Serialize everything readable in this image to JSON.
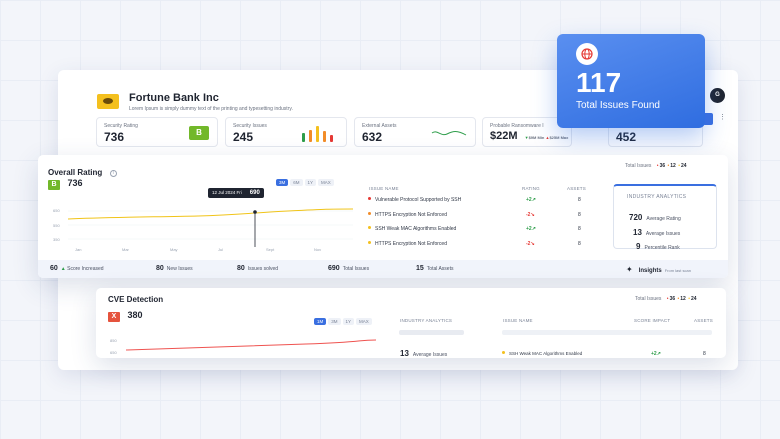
{
  "company": {
    "name": "Fortune Bank Inc",
    "description": "Lorem Ipsum is simply dummy text of the printing and typesetting industry."
  },
  "stats": {
    "security_rating": {
      "label": "Security Rating",
      "value": "736",
      "grade": "B"
    },
    "security_issues": {
      "label": "Security Issues",
      "value": "245"
    },
    "external_assets": {
      "label": "External Assets",
      "value": "632"
    },
    "ransomware": {
      "label": "Probable Ransomware I",
      "value": "$22M",
      "min": "$9M",
      "min_label": "Min",
      "max": "$25M",
      "max_label": "Max"
    },
    "extra": {
      "value": "452"
    }
  },
  "avatar": {
    "initial": "G"
  },
  "total_card": {
    "value": "117",
    "label": "Total Issues Found"
  },
  "overall": {
    "title": "Overall Rating",
    "grade": "B",
    "score": "736",
    "total_issues_label": "Total Issues",
    "ti_a": "36",
    "ti_b": "12",
    "ti_c": "24",
    "tabs": [
      "3M",
      "6M",
      "1Y",
      "MAX"
    ],
    "tooltip_date": "12 Jul 2024 Fri",
    "tooltip_value": "690",
    "ylabels": [
      "650",
      "550",
      "350"
    ],
    "xlabels": [
      "Jan",
      "Mar",
      "May",
      "Jul",
      "Sept",
      "Nov"
    ]
  },
  "issues": {
    "headers": {
      "name": "Issue Name",
      "rating": "Rating",
      "assets": "Assets"
    },
    "rows": [
      {
        "name": "Vulnerable Protocol Supported by SSH",
        "rating": "+2",
        "assets": "8",
        "dot": "#e53935",
        "rating_color": "#2e9d4a"
      },
      {
        "name": "HTTPS Encryption Not Enforced",
        "rating": "-2",
        "assets": "8",
        "dot": "#f28c28",
        "rating_color": "#e53935"
      },
      {
        "name": "SSH Weak MAC Algorithms Enabled",
        "rating": "+2",
        "assets": "8",
        "dot": "#f4c01e",
        "rating_color": "#2e9d4a"
      },
      {
        "name": "HTTPS Encryption Not Enforced",
        "rating": "-2",
        "assets": "8",
        "dot": "#f4c01e",
        "rating_color": "#e53935"
      }
    ]
  },
  "industry": {
    "title": "INDUSTRY ANALYTICS",
    "items": [
      {
        "value": "720",
        "label": "Average Rating"
      },
      {
        "value": "13",
        "label": "Average Issues"
      },
      {
        "value": "9",
        "label": "Percentile Rank"
      }
    ]
  },
  "footer": {
    "score_increased": {
      "value": "60",
      "label": "Score Increased"
    },
    "new_issues": {
      "value": "80",
      "label": "New Issues"
    },
    "issues_solved": {
      "value": "80",
      "label": "Issues solved"
    },
    "total_issues": {
      "value": "690",
      "label": "Total Issues"
    },
    "total_assets": {
      "value": "15",
      "label": "Total Assets"
    },
    "insights": {
      "label": "Insights",
      "sub": "From last scan"
    }
  },
  "cve": {
    "title": "CVE Detection",
    "grade": "X",
    "score": "380",
    "tabs": [
      "1M",
      "3M",
      "1Y",
      "MAX"
    ],
    "total_issues_label": "Total Issues",
    "ti_a": "36",
    "ti_b": "12",
    "ti_c": "24",
    "industry_title": "INDUSTRY ANALYTICS",
    "avg_issues_value": "13",
    "avg_issues_label": "Average Issues",
    "col_issue": "ISSUE NAME",
    "col_impact": "SCORE IMPACT",
    "col_assets": "ASSETS",
    "row_name": "SSH Weak MAC Algorithms Enabled",
    "row_impact": "+2",
    "row_assets": "8",
    "ylabels": [
      "850",
      "650"
    ]
  },
  "colors": {
    "accent": "#3a6fe0",
    "grade_b": "#72b82a",
    "grade_x": "#e5533d",
    "line": "#f0c419",
    "cve_line": "#ef5350"
  }
}
